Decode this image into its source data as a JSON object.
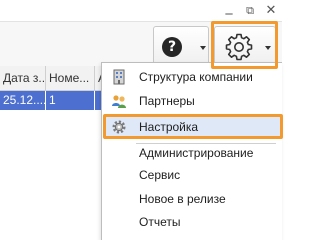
{
  "window": {
    "controls": {
      "minimize": "_",
      "maximize": "⧉",
      "close": "✕"
    }
  },
  "toolbar": {
    "help_glyph": "?",
    "help_icon": "help-circle-icon",
    "settings_icon": "gear-icon"
  },
  "grid": {
    "columns": [
      "Дата з...",
      "Номе...",
      "А"
    ],
    "rows": [
      [
        "25.12....",
        "1",
        ""
      ]
    ],
    "selected_row_color": "#4c6fd0"
  },
  "menu": {
    "items": [
      {
        "label": "Структура компании",
        "icon": "building-icon"
      },
      {
        "label": "Партнеры",
        "icon": "users-icon"
      },
      {
        "label": "Настройка",
        "icon": "gear-icon",
        "selected": true
      },
      {
        "label": "Администрирование"
      },
      {
        "label": "Сервис"
      },
      {
        "label": "Новое в релизе"
      },
      {
        "label": "Отчеты"
      }
    ]
  },
  "colors": {
    "highlight": "#f29a2e",
    "selected_item": "#dfe8f7"
  }
}
